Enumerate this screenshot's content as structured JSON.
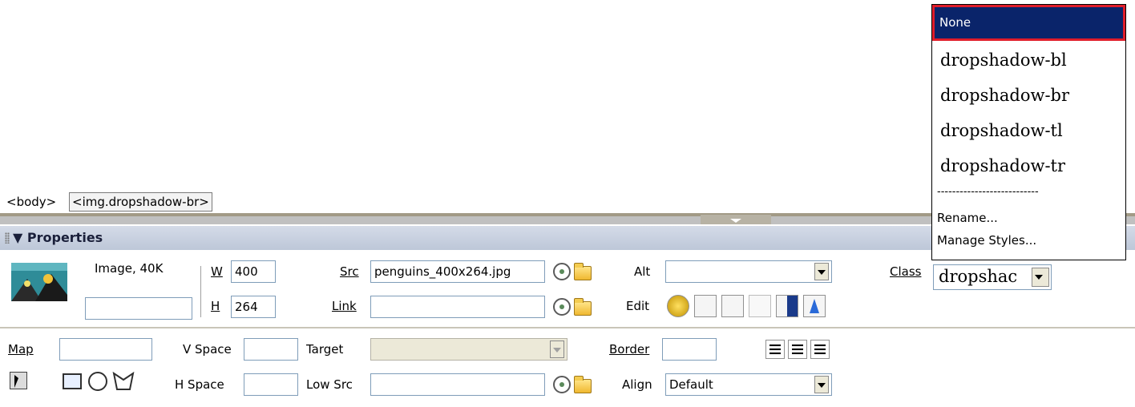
{
  "tag_selector": {
    "body_tag": "<body>",
    "img_tag": "<img.dropshadow-br>"
  },
  "properties": {
    "title": "Properties",
    "image_info": "Image, 40K",
    "image_name": "",
    "w_label": "W",
    "w_value": "400",
    "h_label": "H",
    "h_value": "264",
    "src_label": "Src",
    "src_value": "penguins_400x264.jpg",
    "link_label": "Link",
    "link_value": "",
    "alt_label": "Alt",
    "alt_value": "",
    "edit_label": "Edit",
    "class_label": "Class",
    "class_value": "dropshac",
    "map_label": "Map",
    "map_value": "",
    "vspace_label": "V Space",
    "vspace_value": "",
    "hspace_label": "H Space",
    "hspace_value": "",
    "target_label": "Target",
    "target_value": "",
    "lowsrc_label": "Low Src",
    "lowsrc_value": "",
    "border_label": "Border",
    "border_value": "",
    "align_label": "Align",
    "align_value": "Default"
  },
  "class_menu": {
    "items": [
      "None",
      "dropshadow-bl",
      "dropshadow-br",
      "dropshadow-tl",
      "dropshadow-tr"
    ],
    "separator": "---------------------------",
    "rename": "Rename...",
    "manage": "Manage Styles..."
  },
  "colors": {
    "menu_highlight": "#0a246a",
    "highlight_border": "#e01d2a",
    "header_bg": "#c6cfdf"
  }
}
